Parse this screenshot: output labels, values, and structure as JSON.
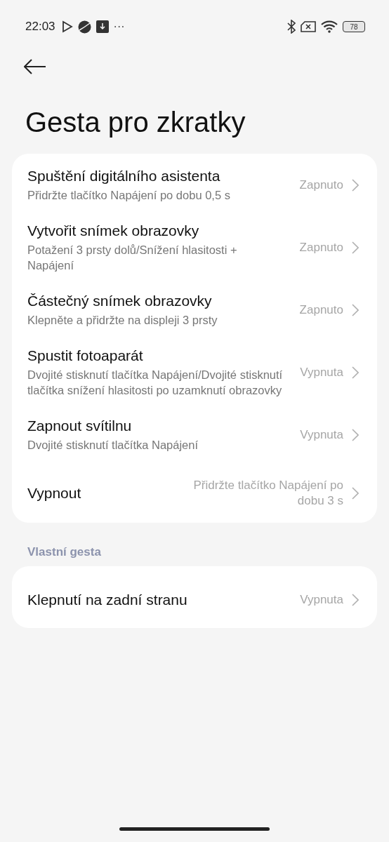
{
  "status_bar": {
    "time": "22:03",
    "notification_more": "···",
    "battery": "78"
  },
  "title": "Gesta pro zkratky",
  "groups": [
    {
      "items": [
        {
          "title": "Spuštění digitálního asistenta",
          "subtitle": "Přidržte tlačítko Napájení po dobu 0,5 s",
          "value": "Zapnuto"
        },
        {
          "title": "Vytvořit snímek obrazovky",
          "subtitle": "Potažení 3 prsty dolů/Snížení hlasitosti + Napájení",
          "value": "Zapnuto"
        },
        {
          "title": "Částečný snímek obrazovky",
          "subtitle": "Klepněte a přidržte na displeji 3 prsty",
          "value": "Zapnuto"
        },
        {
          "title": "Spustit fotoaparát",
          "subtitle": "Dvojité stisknutí tlačítka Napájení/Dvojité stisknutí tlačítka snížení hlasitosti po uzamknutí obrazovky",
          "value": "Vypnuta"
        },
        {
          "title": "Zapnout svítilnu",
          "subtitle": "Dvojité stisknutí tlačítka Napájení",
          "value": "Vypnuta"
        },
        {
          "title": "Vypnout",
          "value": "Přidržte tlačítko Napájení po dobu 3 s"
        }
      ]
    },
    {
      "header": "Vlastní gesta",
      "items": [
        {
          "title": "Klepnutí na zadní stranu",
          "value": "Vypnuta"
        }
      ]
    }
  ]
}
